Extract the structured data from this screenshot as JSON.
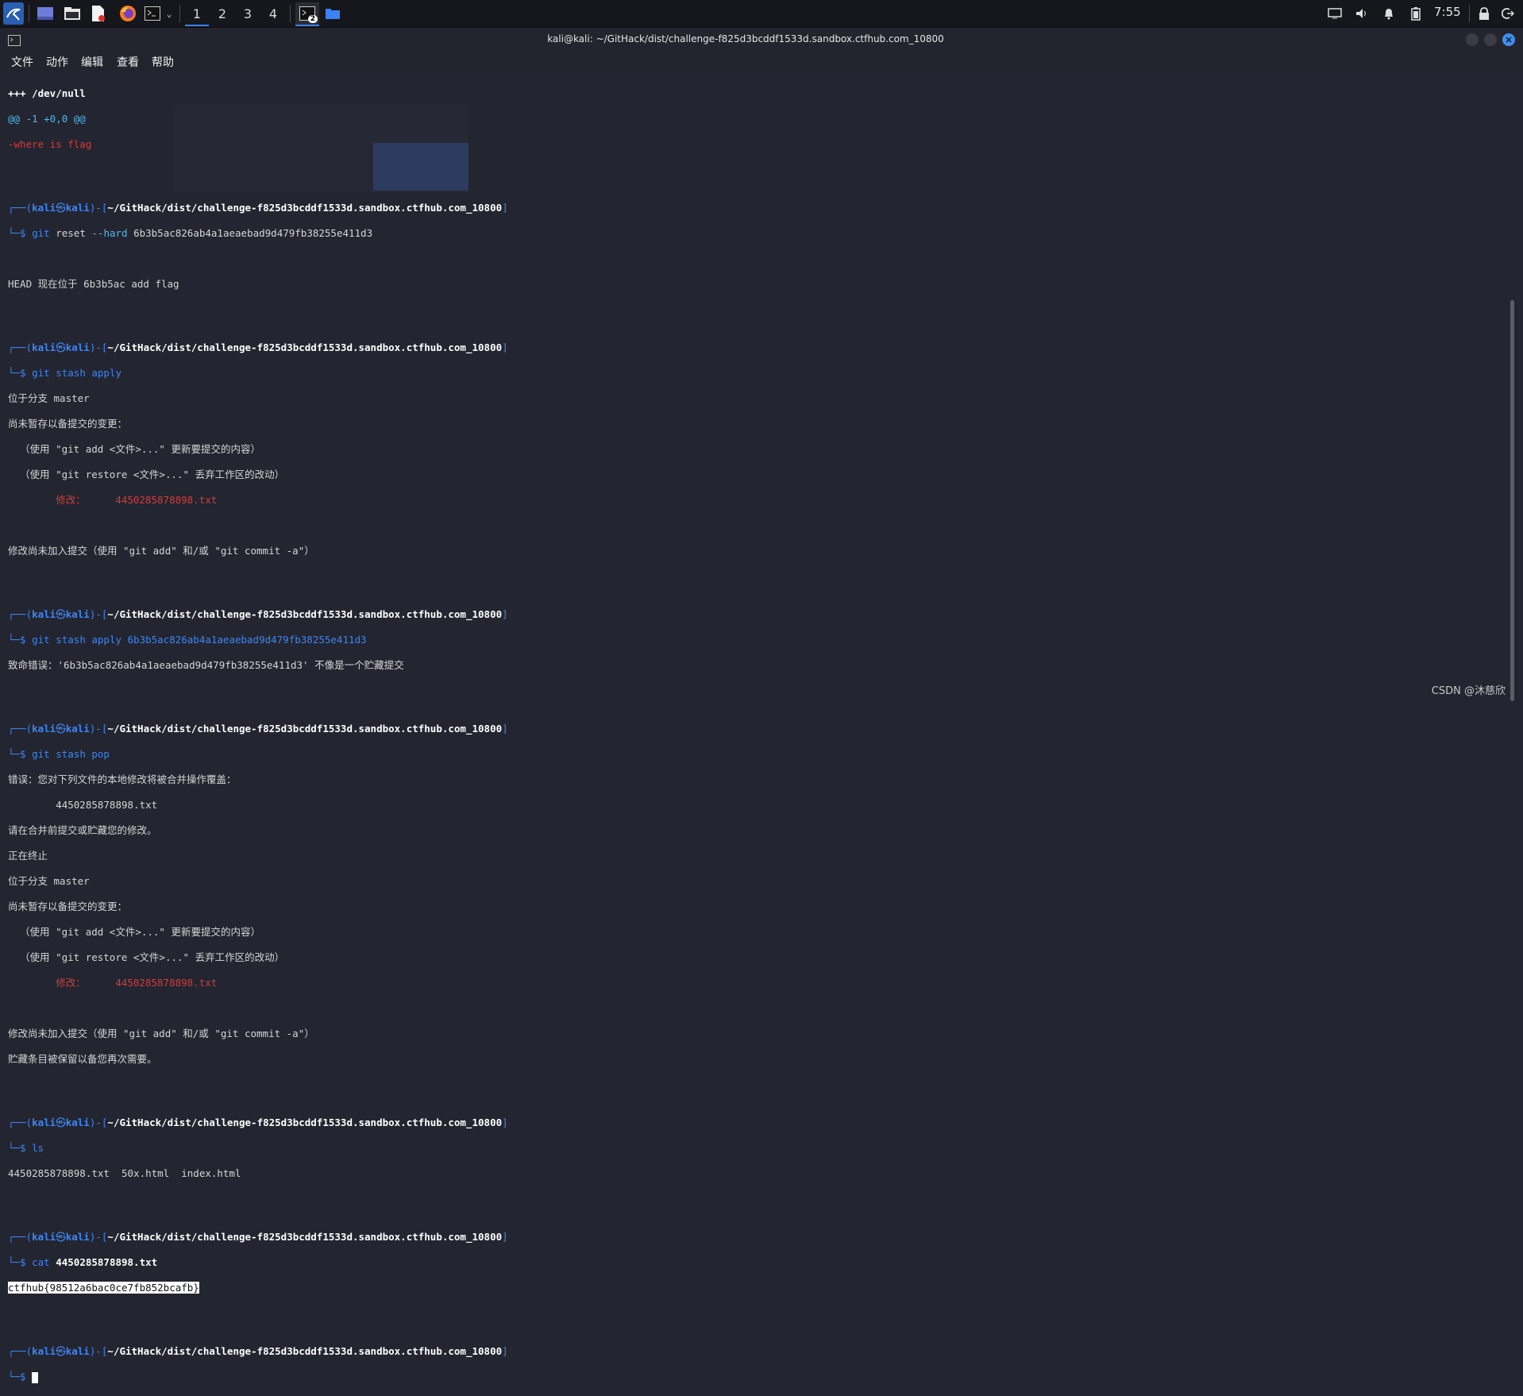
{
  "taskbar": {
    "workspaces": [
      "1",
      "2",
      "3",
      "4"
    ],
    "terminal_badge": "2",
    "clock": "7:55"
  },
  "window": {
    "title": "kali@kali: ~/GitHack/dist/challenge-f825d3bcddf1533d.sandbox.ctfhub.com_10800"
  },
  "menubar": [
    "文件",
    "动作",
    "编辑",
    "查看",
    "帮助"
  ],
  "prompt": {
    "user": "kali",
    "at": "㉿",
    "host": "kali",
    "path": "~/GitHack/dist/challenge-f825d3bcddf1533d.sandbox.ctfhub.com_10800"
  },
  "terminal": {
    "l_devnull": "+++ /dev/null",
    "l_hunk": "@@ -1 +0,0 @@",
    "l_removed": "-where is flag",
    "cmd_reset_git": "git",
    "cmd_reset_sub": "reset",
    "cmd_reset_flag": "--hard",
    "cmd_reset_hash": "6b3b5ac826ab4a1aeaebad9d479fb38255e411d3",
    "out_head": "HEAD 现在位于 6b3b5ac add flag",
    "cmd_stash_apply": "git stash apply",
    "out_branch": "位于分支 master",
    "out_not_staged": "尚未暂存以备提交的变更：",
    "out_hint_add": "  （使用 \"git add <文件>...\" 更新要提交的内容）",
    "out_hint_restore": "  （使用 \"git restore <文件>...\" 丢弃工作区的改动）",
    "out_modified": "        修改：     4450285878898.txt",
    "out_no_changes": "修改尚未加入提交（使用 \"git add\" 和/或 \"git commit -a\"）",
    "cmd_stash_apply_hash": "git stash apply 6b3b5ac826ab4a1aeaebad9d479fb38255e411d3",
    "out_fatal": "致命错误：'6b3b5ac826ab4a1aeaebad9d479fb38255e411d3' 不像是一个贮藏提交",
    "cmd_stash_pop": "git stash pop",
    "out_error": "错误：您对下列文件的本地修改将被合并操作覆盖：",
    "out_file": "        4450285878898.txt",
    "out_please": "请在合并前提交或贮藏您的修改。",
    "out_aborting": "正在终止",
    "out_kept": "贮藏条目被保留以备您再次需要。",
    "cmd_ls": "ls",
    "out_ls": "4450285878898.txt  50x.html  index.html",
    "cmd_cat": "cat",
    "cmd_cat_arg": "4450285878898.txt",
    "out_flag": "ctfhub{98512a6bac0ce7fb852bcafb}"
  },
  "watermark": "CSDN @沐慈欣"
}
